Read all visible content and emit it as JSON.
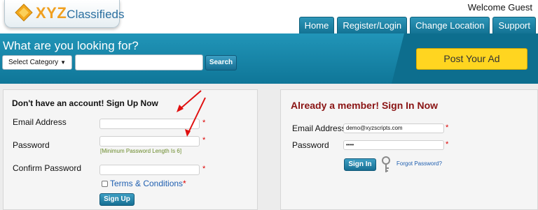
{
  "header": {
    "logo_text": "XYZ",
    "logo_sub": "Classifieds",
    "welcome": "Welcome Guest",
    "nav": [
      "Home",
      "Register/Login",
      "Change Location",
      "Support"
    ]
  },
  "search": {
    "title": "What are you looking for?",
    "category_selected": "Select Category",
    "query_value": "",
    "button_label": "Search",
    "post_ad_label": "Post Your Ad"
  },
  "signup": {
    "title": "Don't have an account! Sign Up Now",
    "email_label": "Email Address",
    "password_label": "Password",
    "password_hint": "[Minimum Password Length Is 6]",
    "confirm_label": "Confirm Password",
    "required_mark": "*",
    "terms_label": "Terms & Conditions",
    "button_label": "Sign Up"
  },
  "signin": {
    "title": "Already a member! Sign In Now",
    "email_label": "Email Address",
    "email_value": "demo@xyzscripts.com",
    "password_label": "Password",
    "password_value": "••••",
    "required_mark": "*",
    "button_label": "Sign In",
    "forgot_label": "Forgot Password?"
  },
  "colors": {
    "accent_blue": "#137394",
    "post_ad_yellow": "#ffd520",
    "signin_title": "#8a1414",
    "annotation_arrow": "#e01010"
  }
}
